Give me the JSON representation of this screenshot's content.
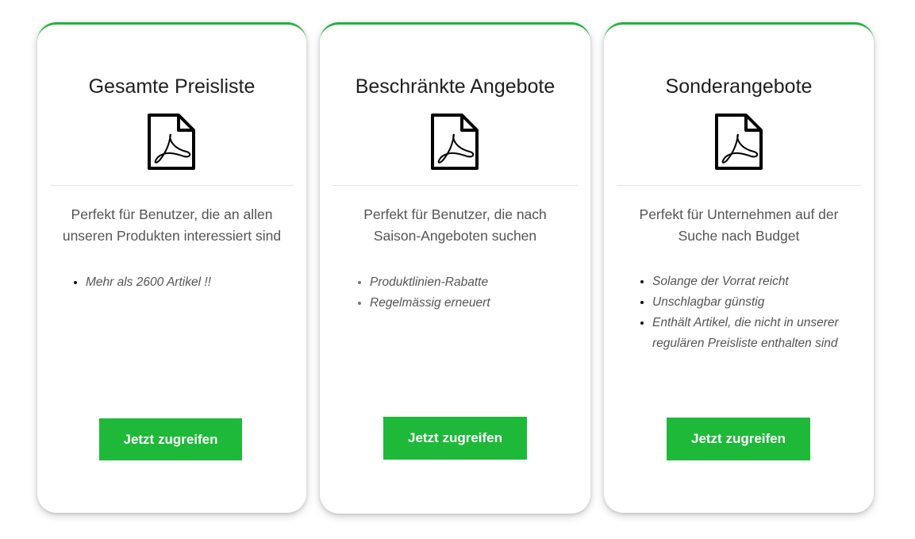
{
  "cards": [
    {
      "title": "Gesamte Preisliste",
      "description": "Perfekt für Benutzer, die an allen unseren Produkten interessiert sind",
      "features": [
        "Mehr als 2600 Artikel !!"
      ],
      "button_label": "Jetzt zugreifen",
      "icon": "pdf-file-icon"
    },
    {
      "title": "Beschränkte Angebote",
      "description": "Perfekt für Benutzer, die nach Saison-Angeboten suchen",
      "features": [
        "Produktlinien-Rabatte",
        "Regelmässig erneuert"
      ],
      "button_label": "Jetzt zugreifen",
      "icon": "pdf-file-icon"
    },
    {
      "title": "Sonderangebote",
      "description": "Perfekt für Unternehmen auf der Suche nach Budget",
      "features": [
        "Solange der Vorrat reicht",
        "Unschlagbar günstig",
        "Enthält Artikel, die nicht in unserer regulären Preisliste enthalten sind"
      ],
      "button_label": "Jetzt zugreifen",
      "icon": "pdf-file-icon"
    }
  ],
  "colors": {
    "accent_green": "#1fb93a",
    "card_border_top": "#22b33d",
    "text_dark": "#1f1f1f",
    "text_muted": "#555555"
  }
}
